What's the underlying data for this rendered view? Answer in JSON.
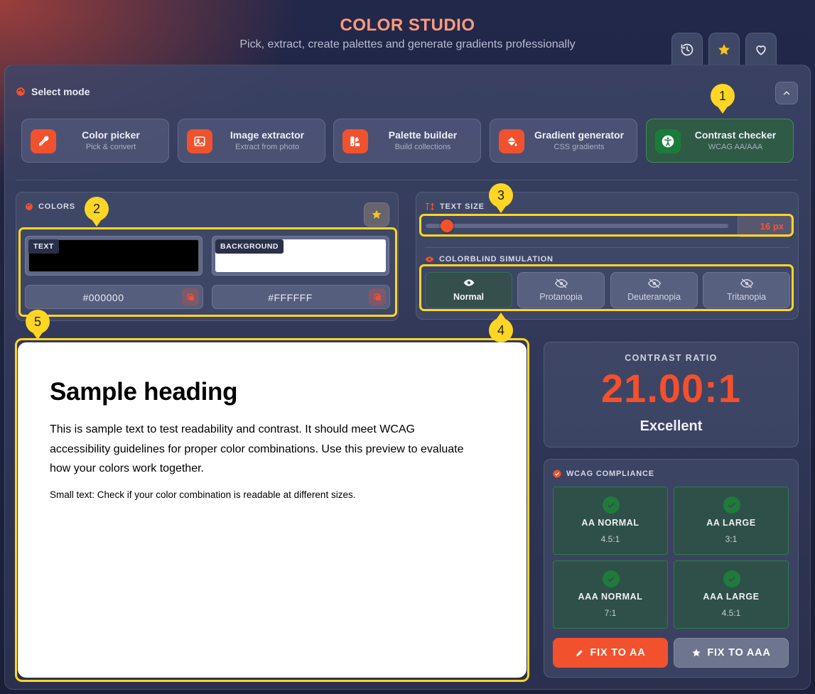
{
  "app": {
    "title": "COLOR STUDIO",
    "subtitle": "Pick, extract, create palettes and generate gradients professionally"
  },
  "header_tabs": [
    {
      "icon": "history-icon"
    },
    {
      "icon": "star-icon"
    },
    {
      "icon": "heart-icon"
    }
  ],
  "mode_selector": {
    "label": "Select mode",
    "modes": [
      {
        "title": "Color picker",
        "subtitle": "Pick & convert",
        "icon": "eyedropper-icon",
        "active": false
      },
      {
        "title": "Image extractor",
        "subtitle": "Extract from photo",
        "icon": "image-icon",
        "active": false
      },
      {
        "title": "Palette builder",
        "subtitle": "Build collections",
        "icon": "swatchbook-icon",
        "active": false
      },
      {
        "title": "Gradient generator",
        "subtitle": "CSS gradients",
        "icon": "paint-bucket-icon",
        "active": false
      },
      {
        "title": "Contrast checker",
        "subtitle": "WCAG AA/AAA",
        "icon": "accessibility-icon",
        "active": true
      }
    ]
  },
  "colors_panel": {
    "label": "COLORS",
    "text": {
      "tag": "TEXT",
      "hex": "#000000",
      "color": "#000000"
    },
    "background": {
      "tag": "BACKGROUND",
      "hex": "#FFFFFF",
      "color": "#FFFFFF"
    }
  },
  "text_size": {
    "label": "TEXT SIZE",
    "value": "16 px",
    "slider_fraction": 0.07
  },
  "colorblind": {
    "label": "COLORBLIND SIMULATION",
    "options": [
      {
        "label": "Normal",
        "icon": "eye-icon",
        "active": true
      },
      {
        "label": "Protanopia",
        "icon": "eye-slash-icon",
        "active": false
      },
      {
        "label": "Deuteranopia",
        "icon": "eye-slash-icon",
        "active": false
      },
      {
        "label": "Tritanopia",
        "icon": "eye-slash-icon",
        "active": false
      }
    ]
  },
  "preview": {
    "heading": "Sample heading",
    "body": "This is sample text to test readability and contrast. It should meet WCAG accessibility guidelines for proper color combinations. Use this preview to evaluate how your colors work together.",
    "small": "Small text: Check if your color combination is readable at different sizes."
  },
  "contrast": {
    "label": "CONTRAST RATIO",
    "value": "21.00:1",
    "verdict": "Excellent"
  },
  "wcag": {
    "label": "WCAG COMPLIANCE",
    "checks": [
      {
        "label": "AA NORMAL",
        "value": "4.5:1",
        "pass": true
      },
      {
        "label": "AA LARGE",
        "value": "3:1",
        "pass": true
      },
      {
        "label": "AAA NORMAL",
        "value": "7:1",
        "pass": true
      },
      {
        "label": "AAA LARGE",
        "value": "4.5:1",
        "pass": true
      }
    ]
  },
  "actions": {
    "fix_aa": "FIX TO AA",
    "fix_aaa": "FIX TO AAA"
  },
  "annotations": [
    "1",
    "2",
    "3",
    "4",
    "5"
  ],
  "colors": {
    "accent": "#F4502C",
    "highlight": "#FFD624",
    "success": "#1F7A3C"
  }
}
